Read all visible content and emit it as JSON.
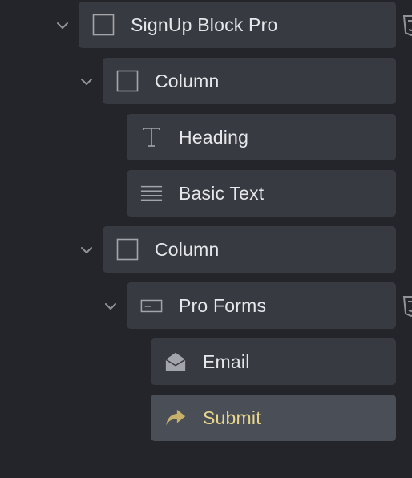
{
  "tree": {
    "nodes": [
      {
        "label": "SignUp Block Pro",
        "icon": "square-icon",
        "expanded": true
      },
      {
        "label": "Column",
        "icon": "square-icon",
        "expanded": true
      },
      {
        "label": "Heading",
        "icon": "text-t-icon"
      },
      {
        "label": "Basic Text",
        "icon": "text-lines-icon"
      },
      {
        "label": "Column",
        "icon": "square-icon",
        "expanded": true
      },
      {
        "label": "Pro Forms",
        "icon": "form-field-icon",
        "expanded": true
      },
      {
        "label": "Email",
        "icon": "open-envelope-icon"
      },
      {
        "label": "Submit",
        "icon": "share-arrow-icon",
        "selected": true
      }
    ]
  },
  "colors": {
    "background": "#23252a",
    "node": "#373a41",
    "node_selected": "#4a4e57",
    "text": "#e6e7ea",
    "text_selected": "#e8d58a",
    "icon": "#9a9ca3",
    "icon_selected": "#c6b06a"
  }
}
